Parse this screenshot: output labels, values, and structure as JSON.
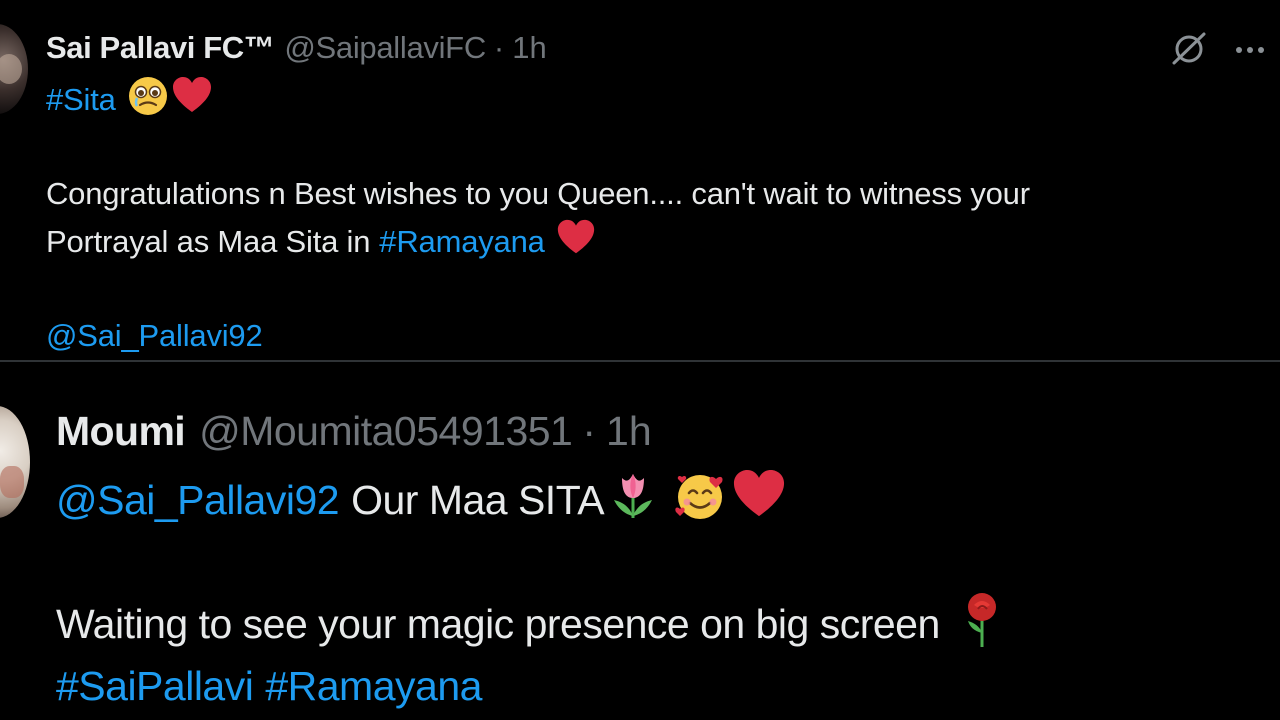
{
  "tweets": [
    {
      "display_name": "Sai Pallavi FC™",
      "handle": "@SaipallaviFC",
      "separator": "·",
      "time": "1h",
      "hashtag_line": "#Sita",
      "body_line1": "Congratulations n Best wishes to you Queen.... can't wait to witness your",
      "body_line2_text": "Portrayal as Maa Sita in",
      "body_line2_hashtag": "#Ramayana",
      "mention": "@Sai_Pallavi92",
      "icons": [
        "crying-face-icon",
        "heart-icon",
        "heart-icon",
        "grok-icon",
        "more-icon"
      ]
    },
    {
      "display_name": "Moumi",
      "handle": "@Moumita05491351",
      "separator": "·",
      "time": "1h",
      "mention": "@Sai_Pallavi92",
      "line1_text": "Our Maa SITA",
      "body_line": "Waiting to see your magic presence on big screen",
      "hashtag1": "#SaiPallavi",
      "hashtag2": "#Ramayana",
      "icons": [
        "tulip-icon",
        "smiling-face-with-hearts-icon",
        "heart-icon",
        "rose-icon"
      ]
    }
  ],
  "colors": {
    "background": "#000000",
    "text": "#e7e9ea",
    "muted": "#71767b",
    "link": "#1d9bf0",
    "heart": "#e0245e",
    "divider": "#2f3336"
  }
}
